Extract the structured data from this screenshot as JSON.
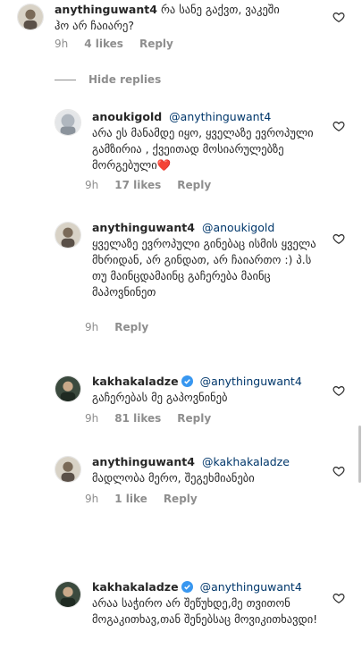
{
  "comments": [
    {
      "username": "anythinguwant4",
      "mention": "",
      "text": "რა სანე გაქვთ, ვაკეში ჰო არ ჩაიარე?",
      "time": "9h",
      "likes": "4 likes",
      "reply": "Reply",
      "avatar_icon": "avatar-icon"
    },
    {
      "username": "anoukigold",
      "mention": "@anythinguwant4",
      "text": "არა ეს მანამდე იყო, ყველაზე ევროპული გამზირია , ქვეითად მოსიარულებზე მორგებული❤️",
      "time": "9h",
      "likes": "17 likes",
      "reply": "Reply",
      "avatar_icon": "avatar-icon"
    },
    {
      "username": "anythinguwant4",
      "mention": "@anoukigold",
      "text": "ყველაზე ევროპული გინებაც ისმის ყველა მხრიდან, არ გინდათ, არ ჩაიართო :) პ.ს თუ მაინცდამაინც გაჩერება მაინც მაპოვნინეთ",
      "time": "9h",
      "likes": "",
      "reply": "Reply",
      "avatar_icon": "avatar-icon"
    },
    {
      "username": "kakhakaladze",
      "verified": true,
      "mention": "@anythinguwant4",
      "text": "გაჩერებას მე გაპოვნინებ",
      "time": "9h",
      "likes": "81 likes",
      "reply": "Reply",
      "avatar_icon": "avatar-icon"
    },
    {
      "username": "anythinguwant4",
      "mention": "@kakhakaladze",
      "text": "მადლობა მერო, შეგეხმიანები",
      "time": "9h",
      "likes": "1 like",
      "reply": "Reply",
      "avatar_icon": "avatar-icon"
    },
    {
      "username": "kakhakaladze",
      "verified": true,
      "mention": "@anythinguwant4",
      "text": "არაა საჭირო არ შეწუხდე,მე თვითონ მოგაკითხავ,თან შენებსაც მოვიკითხავდი!",
      "time": "",
      "likes": "",
      "reply": "",
      "avatar_icon": "avatar-icon"
    }
  ],
  "hide_replies_label": "Hide replies",
  "icons": {
    "like": "heart-icon",
    "verified": "verified-badge-icon"
  },
  "colors": {
    "text": "#262626",
    "meta": "#8e8e8e",
    "mention": "#00376b",
    "verified": "#3897f0",
    "heart_outline": "#262626"
  }
}
